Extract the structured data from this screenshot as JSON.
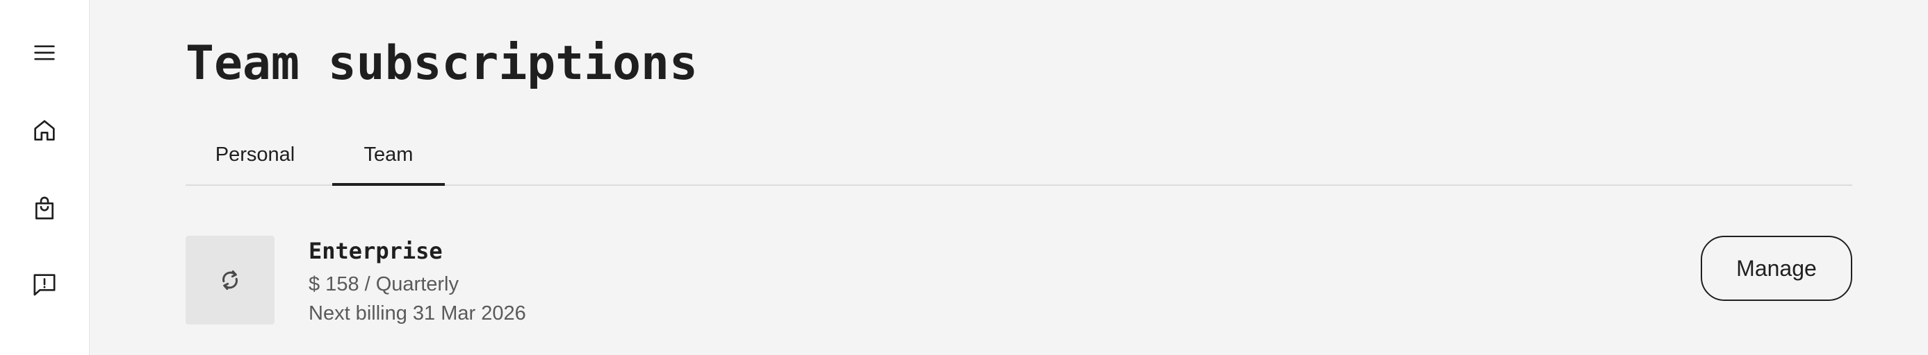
{
  "sidebar": {
    "items": [
      {
        "icon": "menu-icon"
      },
      {
        "icon": "home-icon"
      },
      {
        "icon": "shopping-bag-icon"
      },
      {
        "icon": "feedback-icon"
      }
    ]
  },
  "page": {
    "title": "Team subscriptions"
  },
  "tabs": [
    {
      "label": "Personal",
      "active": false
    },
    {
      "label": "Team",
      "active": true
    }
  ],
  "subscriptions": [
    {
      "icon": "renew-icon",
      "name": "Enterprise",
      "price": "$ 158 / Quarterly",
      "billing": "Next billing 31 Mar 2026",
      "action_label": "Manage"
    }
  ],
  "colors": {
    "background": "#f4f4f4",
    "sidebar": "#ffffff",
    "text": "#1f1f1f",
    "muted_text": "#5a5a5a",
    "icon_tile": "#e5e5e6"
  }
}
